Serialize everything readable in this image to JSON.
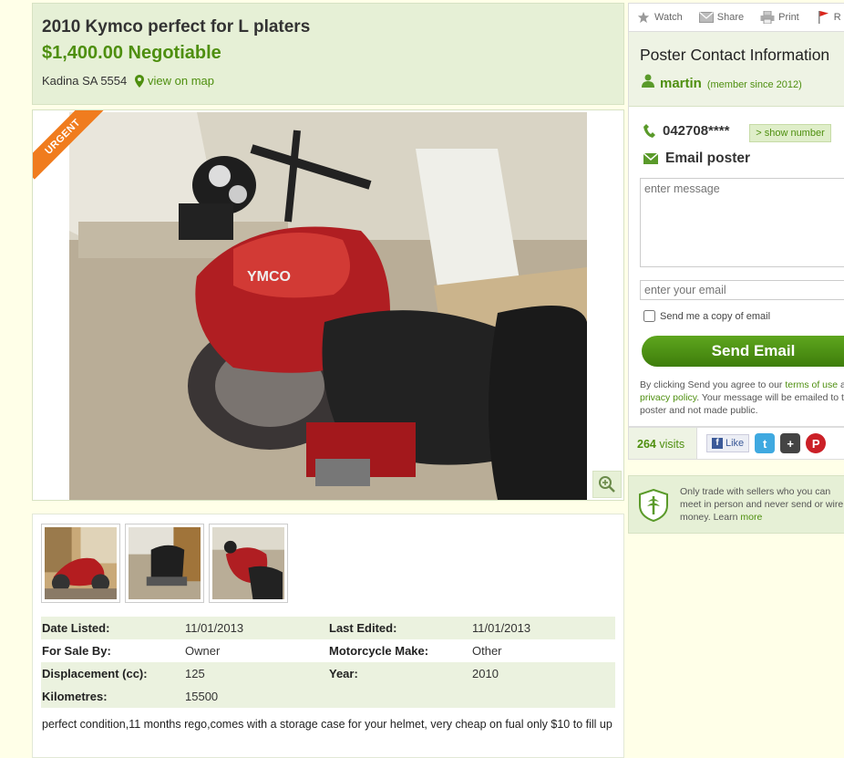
{
  "listing": {
    "title": "2010 Kymco perfect for L platers",
    "price": "$1,400.00 Negotiable",
    "location": "Kadina SA 5554",
    "map_link": "view on map",
    "urgent_badge": "URGENT"
  },
  "attributes": [
    {
      "k1": "Date Listed:",
      "v1": "11/01/2013",
      "k2": "Last Edited:",
      "v2": "11/01/2013"
    },
    {
      "k1": "For Sale By:",
      "v1": "Owner",
      "k2": "Motorcycle Make:",
      "v2": "Other"
    },
    {
      "k1": "Displacement (cc):",
      "v1": "125",
      "k2": "Year:",
      "v2": "2010"
    },
    {
      "k1": "Kilometres:",
      "v1": "15500",
      "k2": "",
      "v2": ""
    }
  ],
  "description": "perfect condition,11 months rego,comes with a storage case for your helmet, very cheap on fual only $10 to fill up",
  "toolbar": {
    "watch": "Watch",
    "share": "Share",
    "print": "Print",
    "report": "R"
  },
  "contact": {
    "title": "Poster Contact Information",
    "member_name": "martin",
    "member_since": "(member since 2012)",
    "phone": "042708****",
    "show_number": "> show number",
    "email_label": "Email poster",
    "message_placeholder": "enter message",
    "email_placeholder": "enter your email",
    "copy_label": "Send me a copy of email",
    "send_button": "Send Email",
    "legal_prefix": "By clicking Send you agree to our ",
    "terms_link": "terms of use",
    "legal_and": " and ",
    "privacy_link": "privacy policy",
    "legal_suffix": ". Your message will be emailed to the poster and not made public."
  },
  "stats": {
    "visits_count": "264",
    "visits_label": "visits",
    "like_label": "Like"
  },
  "safety": {
    "text": "Only trade with sellers who you can meet in person and never send or wire money. Learn",
    "more": "more"
  },
  "colors": {
    "accent_green": "#4e8f0f",
    "header_bg": "#e6f0d6",
    "urgent_orange": "#f07c1e"
  }
}
